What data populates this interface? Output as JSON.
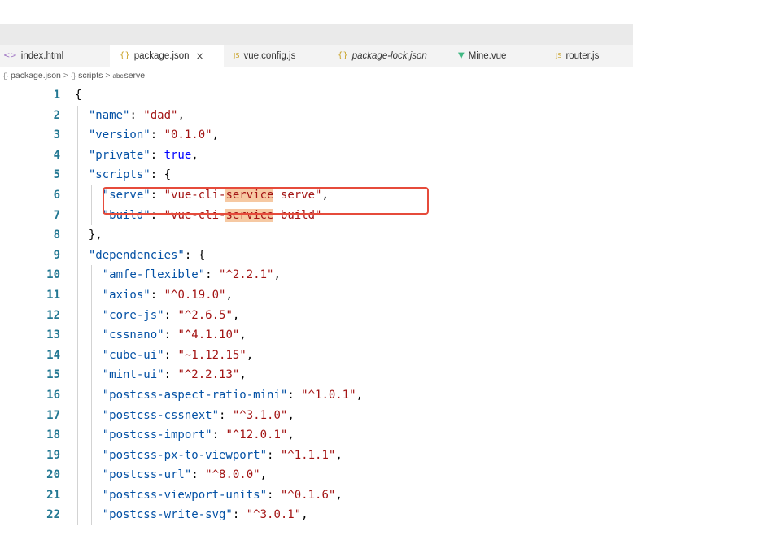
{
  "tabs": [
    {
      "icon": "<>",
      "label": "index.html",
      "active": false,
      "italic": false
    },
    {
      "icon": "{}",
      "label": "package.json",
      "active": true,
      "italic": false
    },
    {
      "icon": "JS",
      "label": "vue.config.js",
      "active": false,
      "italic": false
    },
    {
      "icon": "{}",
      "label": "package-lock.json",
      "active": false,
      "italic": true
    },
    {
      "icon": "▼",
      "label": "Mine.vue",
      "active": false,
      "italic": false
    },
    {
      "icon": "JS",
      "label": "router.js",
      "active": false,
      "italic": false
    }
  ],
  "tab_close": "×",
  "breadcrumb": {
    "file": "package.json",
    "section": "scripts",
    "item": "serve",
    "separator": ">"
  },
  "colors": {
    "line_number": "#237893",
    "key": "#0451a5",
    "string": "#a31515",
    "keyword": "#0000ff",
    "match_highlight": "#f6c9a3",
    "annotation_box": "#e64b3b"
  },
  "lines": [
    {
      "n": "1",
      "depth": 0,
      "segs": [
        [
          "p",
          "{"
        ]
      ]
    },
    {
      "n": "2",
      "depth": 1,
      "segs": [
        [
          "k",
          "\"name\""
        ],
        [
          "p",
          ": "
        ],
        [
          "s",
          "\"dad\""
        ],
        [
          "p",
          ","
        ]
      ]
    },
    {
      "n": "3",
      "depth": 1,
      "segs": [
        [
          "k",
          "\"version\""
        ],
        [
          "p",
          ": "
        ],
        [
          "s",
          "\"0.1.0\""
        ],
        [
          "p",
          ","
        ]
      ]
    },
    {
      "n": "4",
      "depth": 1,
      "segs": [
        [
          "k",
          "\"private\""
        ],
        [
          "p",
          ": "
        ],
        [
          "b",
          "true"
        ],
        [
          "p",
          ","
        ]
      ]
    },
    {
      "n": "5",
      "depth": 1,
      "segs": [
        [
          "k",
          "\"scripts\""
        ],
        [
          "p",
          ": {"
        ]
      ]
    },
    {
      "n": "6",
      "depth": 2,
      "segs": [
        [
          "k",
          "\"serve\""
        ],
        [
          "p",
          ": "
        ],
        [
          "s",
          "\"vue-cli-"
        ],
        [
          "sh",
          "service"
        ],
        [
          "s",
          " serve\""
        ],
        [
          "p",
          ","
        ]
      ]
    },
    {
      "n": "7",
      "depth": 2,
      "segs": [
        [
          "k",
          "\"build\""
        ],
        [
          "p",
          ": "
        ],
        [
          "s",
          "\"vue-cli-"
        ],
        [
          "sh",
          "service"
        ],
        [
          "s",
          " build\""
        ]
      ]
    },
    {
      "n": "8",
      "depth": 1,
      "segs": [
        [
          "p",
          "},"
        ]
      ]
    },
    {
      "n": "9",
      "depth": 1,
      "segs": [
        [
          "k",
          "\"dependencies\""
        ],
        [
          "p",
          ": {"
        ]
      ]
    },
    {
      "n": "10",
      "depth": 2,
      "segs": [
        [
          "k",
          "\"amfe-flexible\""
        ],
        [
          "p",
          ": "
        ],
        [
          "s",
          "\"^2.2.1\""
        ],
        [
          "p",
          ","
        ]
      ]
    },
    {
      "n": "11",
      "depth": 2,
      "segs": [
        [
          "k",
          "\"axios\""
        ],
        [
          "p",
          ": "
        ],
        [
          "s",
          "\"^0.19.0\""
        ],
        [
          "p",
          ","
        ]
      ]
    },
    {
      "n": "12",
      "depth": 2,
      "segs": [
        [
          "k",
          "\"core-js\""
        ],
        [
          "p",
          ": "
        ],
        [
          "s",
          "\"^2.6.5\""
        ],
        [
          "p",
          ","
        ]
      ]
    },
    {
      "n": "13",
      "depth": 2,
      "segs": [
        [
          "k",
          "\"cssnano\""
        ],
        [
          "p",
          ": "
        ],
        [
          "s",
          "\"^4.1.10\""
        ],
        [
          "p",
          ","
        ]
      ]
    },
    {
      "n": "14",
      "depth": 2,
      "segs": [
        [
          "k",
          "\"cube-ui\""
        ],
        [
          "p",
          ": "
        ],
        [
          "s",
          "\"~1.12.15\""
        ],
        [
          "p",
          ","
        ]
      ]
    },
    {
      "n": "15",
      "depth": 2,
      "segs": [
        [
          "k",
          "\"mint-ui\""
        ],
        [
          "p",
          ": "
        ],
        [
          "s",
          "\"^2.2.13\""
        ],
        [
          "p",
          ","
        ]
      ]
    },
    {
      "n": "16",
      "depth": 2,
      "segs": [
        [
          "k",
          "\"postcss-aspect-ratio-mini\""
        ],
        [
          "p",
          ": "
        ],
        [
          "s",
          "\"^1.0.1\""
        ],
        [
          "p",
          ","
        ]
      ]
    },
    {
      "n": "17",
      "depth": 2,
      "segs": [
        [
          "k",
          "\"postcss-cssnext\""
        ],
        [
          "p",
          ": "
        ],
        [
          "s",
          "\"^3.1.0\""
        ],
        [
          "p",
          ","
        ]
      ]
    },
    {
      "n": "18",
      "depth": 2,
      "segs": [
        [
          "k",
          "\"postcss-import\""
        ],
        [
          "p",
          ": "
        ],
        [
          "s",
          "\"^12.0.1\""
        ],
        [
          "p",
          ","
        ]
      ]
    },
    {
      "n": "19",
      "depth": 2,
      "segs": [
        [
          "k",
          "\"postcss-px-to-viewport\""
        ],
        [
          "p",
          ": "
        ],
        [
          "s",
          "\"^1.1.1\""
        ],
        [
          "p",
          ","
        ]
      ]
    },
    {
      "n": "20",
      "depth": 2,
      "segs": [
        [
          "k",
          "\"postcss-url\""
        ],
        [
          "p",
          ": "
        ],
        [
          "s",
          "\"^8.0.0\""
        ],
        [
          "p",
          ","
        ]
      ]
    },
    {
      "n": "21",
      "depth": 2,
      "segs": [
        [
          "k",
          "\"postcss-viewport-units\""
        ],
        [
          "p",
          ": "
        ],
        [
          "s",
          "\"^0.1.6\""
        ],
        [
          "p",
          ","
        ]
      ]
    },
    {
      "n": "22",
      "depth": 2,
      "segs": [
        [
          "k",
          "\"postcss-write-svg\""
        ],
        [
          "p",
          ": "
        ],
        [
          "s",
          "\"^3.0.1\""
        ],
        [
          "p",
          ","
        ]
      ]
    }
  ]
}
